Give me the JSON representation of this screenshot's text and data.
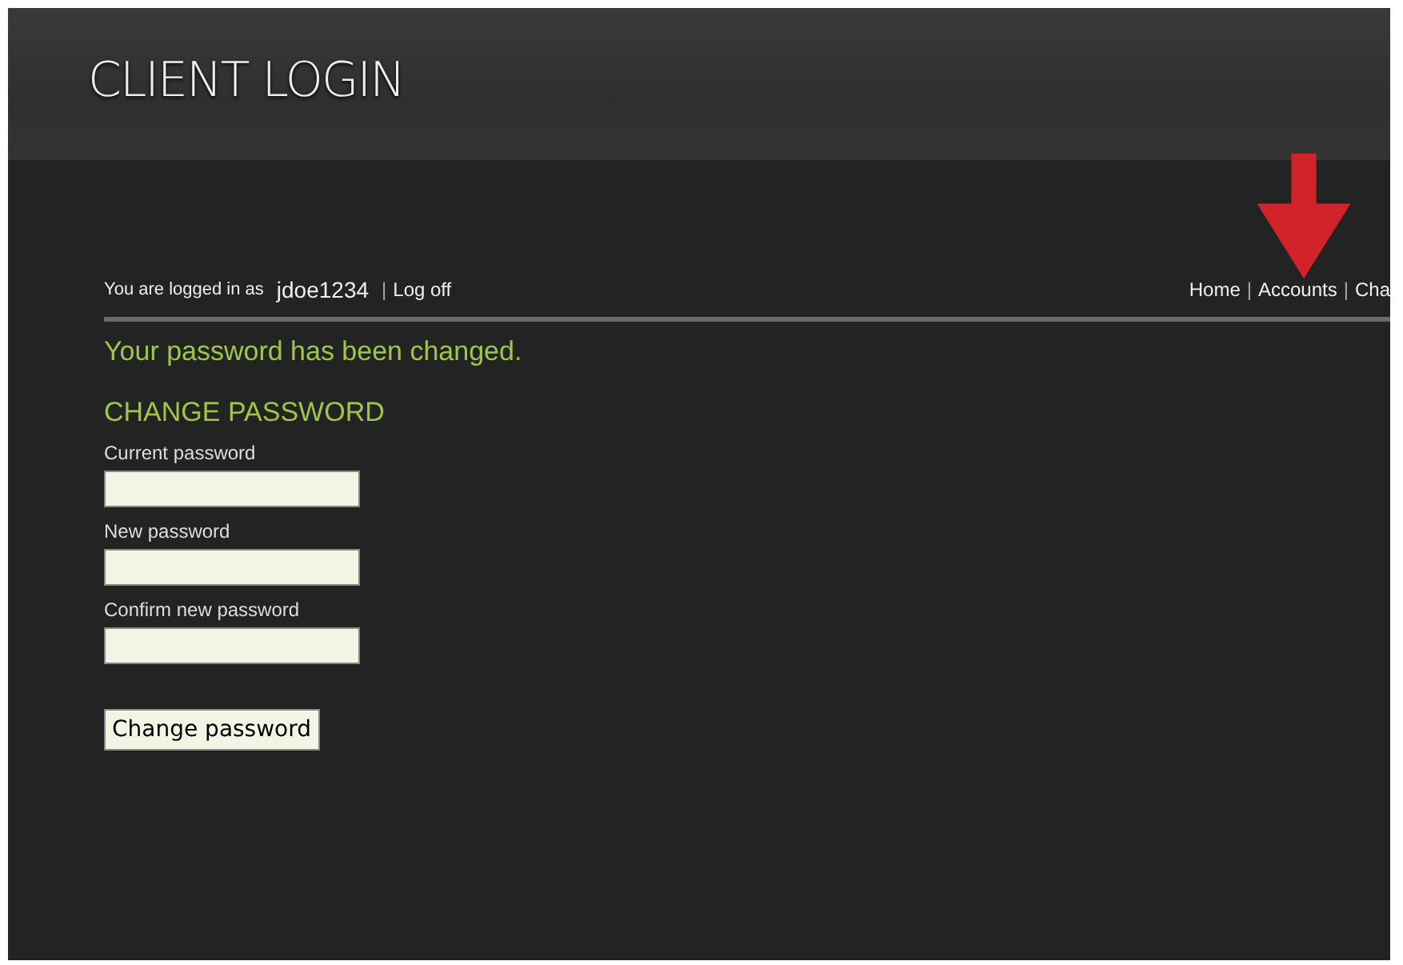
{
  "header": {
    "title": "CLIENT LOGIN"
  },
  "user_bar": {
    "prefix": "You are logged in as",
    "username": "jdoe1234",
    "separator": "|",
    "logoff": "Log off"
  },
  "nav": [
    {
      "label": "Home"
    },
    {
      "label": "Accounts"
    },
    {
      "label": "Cha"
    }
  ],
  "nav_separator": "|",
  "message": "Your password has been changed.",
  "form": {
    "heading": "CHANGE PASSWORD",
    "fields": [
      {
        "label": "Current password"
      },
      {
        "label": "New password"
      },
      {
        "label": "Confirm new password"
      }
    ],
    "submit": "Change password"
  }
}
